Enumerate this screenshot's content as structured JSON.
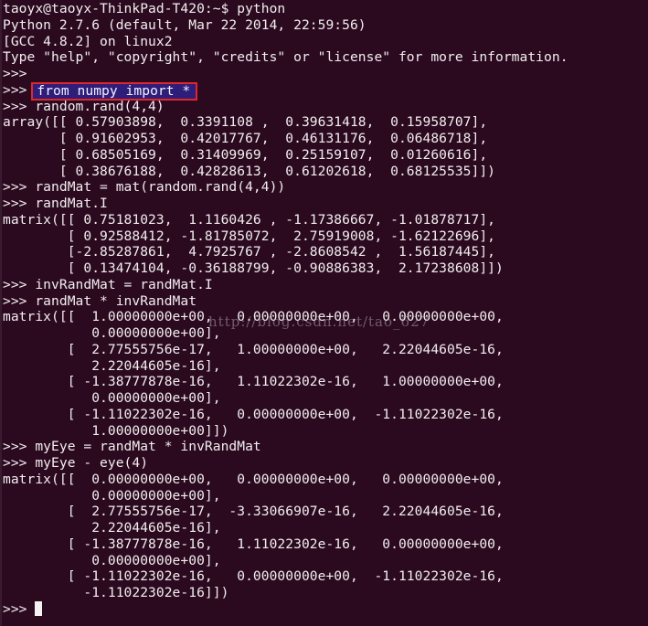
{
  "terminal": {
    "shell_prompt": "taoyx@taoyx-ThinkPad-T420:~$ ",
    "shell_command": "python",
    "banner": [
      "Python 2.7.6 (default, Mar 22 2014, 22:59:56)",
      "[GCC 4.8.2] on linux2",
      "Type \"help\", \"copyright\", \"credits\" or \"license\" for more information."
    ],
    "ps1": ">>> ",
    "highlighted_command": "from numpy import *",
    "highlight_color": "#e0262c",
    "lines": [
      ">>> random.rand(4,4)",
      "array([[ 0.57903898,  0.3391108 ,  0.39631418,  0.15958707],",
      "       [ 0.91602953,  0.42017767,  0.46131176,  0.06486718],",
      "       [ 0.68505169,  0.31409969,  0.25159107,  0.01260616],",
      "       [ 0.38676188,  0.42828613,  0.61202618,  0.68125535]])",
      ">>> randMat = mat(random.rand(4,4))",
      ">>> randMat.I",
      "matrix([[ 0.75181023,  1.1160426 , -1.17386667, -1.01878717],",
      "        [ 0.92588412, -1.81785072,  2.75919008, -1.62122696],",
      "        [-2.85287861,  4.7925767 , -2.8608542 ,  1.56187445],",
      "        [ 0.13474104, -0.36188799, -0.90886383,  2.17238608]])",
      ">>> invRandMat = randMat.I",
      ">>> randMat * invRandMat",
      "matrix([[  1.00000000e+00,   0.00000000e+00,   0.00000000e+00,",
      "           0.00000000e+00],",
      "        [  2.77555756e-17,   1.00000000e+00,   2.22044605e-16,",
      "           2.22044605e-16],",
      "        [ -1.38777878e-16,   1.11022302e-16,   1.00000000e+00,",
      "           0.00000000e+00],",
      "        [ -1.11022302e-16,   0.00000000e+00,  -1.11022302e-16,",
      "           1.00000000e+00]])",
      ">>> myEye = randMat * invRandMat",
      ">>> myEye - eye(4)",
      "matrix([[  0.00000000e+00,   0.00000000e+00,   0.00000000e+00,",
      "           0.00000000e+00],",
      "        [  2.77555756e-17,  -3.33066907e-16,   2.22044605e-16,",
      "           2.22044605e-16],",
      "        [ -1.38777878e-16,   1.11022302e-16,   0.00000000e+00,",
      "           0.00000000e+00],",
      "        [ -1.11022302e-16,   0.00000000e+00,  -1.11022302e-16,",
      "          -1.11022302e-16]])"
    ],
    "final_prompt": ">>> ",
    "watermark": "http://blog.csdn.net/tao_627"
  }
}
